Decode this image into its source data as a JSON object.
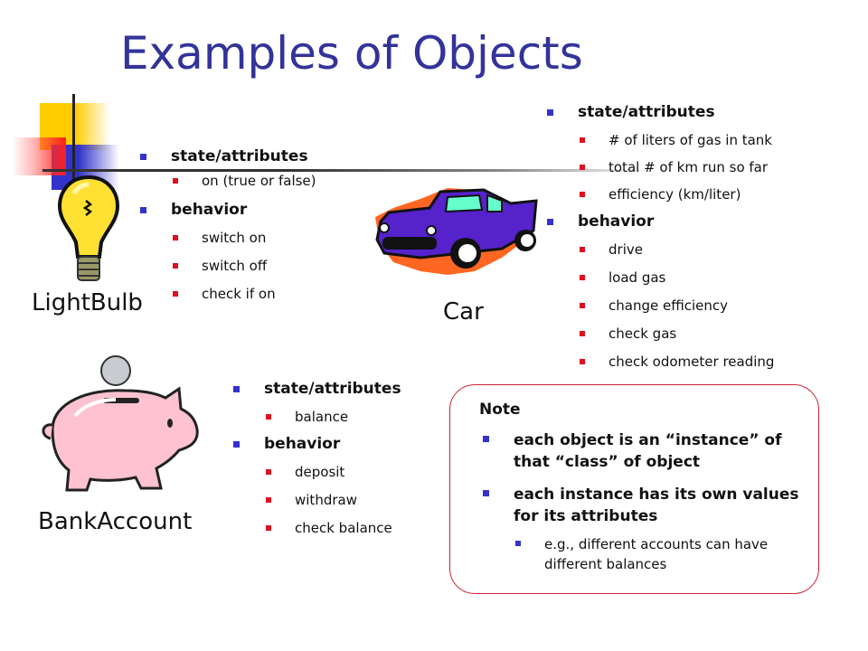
{
  "title": "Examples of Objects",
  "objects": [
    {
      "name": "LightBulb",
      "icon": "lightbulb-icon",
      "groups": [
        {
          "heading": "state/attributes",
          "items": [
            "on (true or false)"
          ]
        },
        {
          "heading": "behavior",
          "items": [
            "switch on",
            "switch off",
            "check if on"
          ]
        }
      ]
    },
    {
      "name": "Car",
      "icon": "car-icon",
      "groups": [
        {
          "heading": "state/attributes",
          "items": [
            "# of liters of gas in tank",
            "total # of km run so far",
            "efficiency (km/liter)"
          ]
        },
        {
          "heading": "behavior",
          "items": [
            "drive",
            "load gas",
            "change efficiency",
            "check gas",
            "check odometer reading"
          ]
        }
      ]
    },
    {
      "name": "BankAccount",
      "icon": "piggy-bank-icon",
      "groups": [
        {
          "heading": "state/attributes",
          "items": [
            "balance"
          ]
        },
        {
          "heading": "behavior",
          "items": [
            "deposit",
            "withdraw",
            "check balance"
          ]
        }
      ]
    }
  ],
  "note": {
    "heading": "Note",
    "points": [
      "each object is an “instance” of that “class” of object",
      "each instance has its own values for its attributes"
    ],
    "subpoint": "e.g., different accounts can have different balances"
  },
  "colors": {
    "title": "#33339a",
    "bullet_primary": "#3333cc",
    "bullet_secondary": "#e01020",
    "note_border": "#cc2233"
  }
}
